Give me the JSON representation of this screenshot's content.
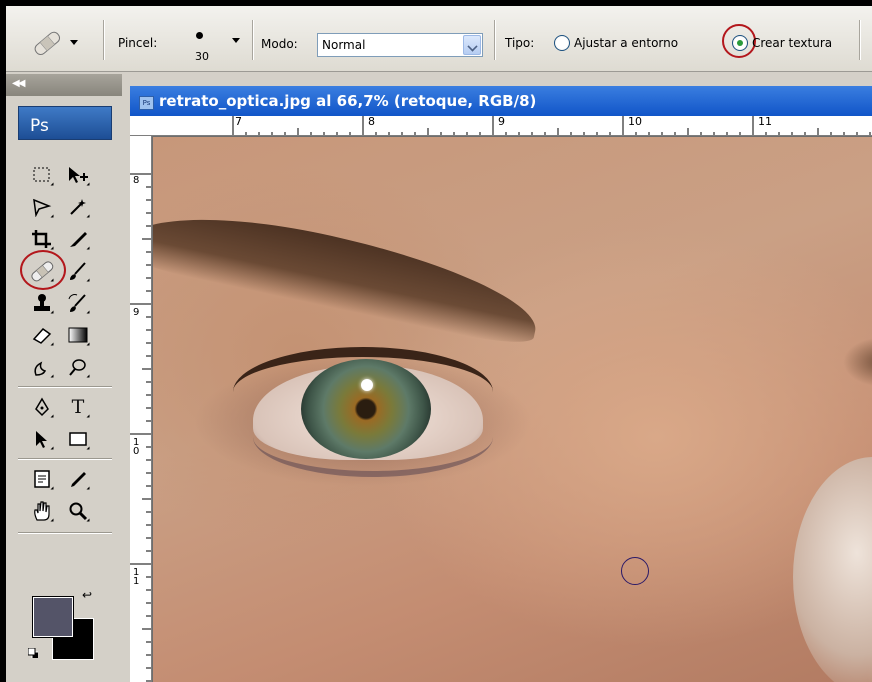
{
  "options_bar": {
    "tool_preset_icon": "band-aid-icon",
    "brush_label": "Pincel:",
    "brush_size": "30",
    "mode_label": "Modo:",
    "mode_value": "Normal",
    "type_label": "Tipo:",
    "type_options": [
      {
        "label": "Ajustar a entorno",
        "checked": false
      },
      {
        "label": "Crear textura",
        "checked": true
      }
    ]
  },
  "toolbox": {
    "logo": "Ps",
    "tools": [
      "rectangular-marquee-icon",
      "move-icon",
      "lasso-icon",
      "magic-wand-icon",
      "crop-icon",
      "slice-icon",
      "spot-healing-brush-icon",
      "brush-icon",
      "clone-stamp-icon",
      "history-brush-icon",
      "eraser-icon",
      "gradient-icon",
      "blur-icon",
      "dodge-icon",
      "pen-icon",
      "type-icon",
      "path-selection-icon",
      "rectangle-shape-icon",
      "notes-icon",
      "eyedropper-icon",
      "hand-icon",
      "zoom-icon"
    ],
    "type_tool_glyph": "T",
    "foreground_color": "#545468",
    "background_color": "#000000"
  },
  "document": {
    "title": "retrato_optica.jpg al 66,7% (retoque, RGB/8)",
    "ruler_top_labels": [
      "7",
      "8",
      "9",
      "10",
      "11"
    ],
    "ruler_left_labels": [
      "8",
      "9",
      "10",
      "11"
    ]
  },
  "highlight_color": "#b3171c"
}
